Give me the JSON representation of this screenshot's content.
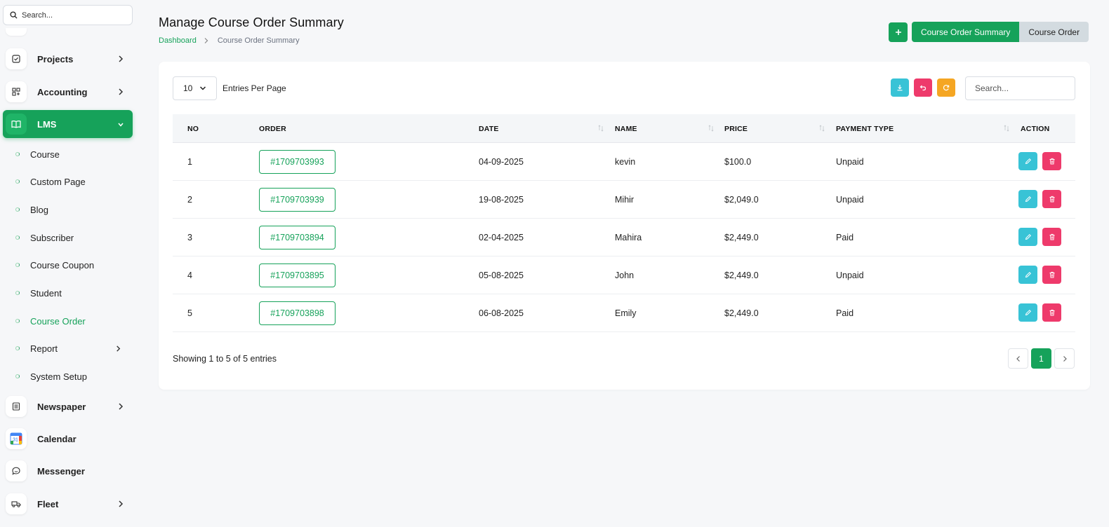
{
  "sidebar": {
    "search_placeholder": "Search...",
    "items": [
      {
        "label": "Projects",
        "icon": "checkbox-icon"
      },
      {
        "label": "Accounting",
        "icon": "grid-plus-icon"
      },
      {
        "label": "LMS",
        "icon": "book-open-icon"
      },
      {
        "label": "Newspaper",
        "icon": "newspaper-icon"
      },
      {
        "label": "Calendar",
        "icon": "calendar-app-icon"
      },
      {
        "label": "Messenger",
        "icon": "chat-icon"
      },
      {
        "label": "Fleet",
        "icon": "truck-icon"
      }
    ],
    "lms_sub": [
      {
        "label": "Course"
      },
      {
        "label": "Custom Page"
      },
      {
        "label": "Blog"
      },
      {
        "label": "Subscriber"
      },
      {
        "label": "Course Coupon"
      },
      {
        "label": "Student"
      },
      {
        "label": "Course Order"
      },
      {
        "label": "Report"
      },
      {
        "label": "System Setup"
      }
    ],
    "calendar_icon_text": "31"
  },
  "header": {
    "title": "Manage Course Order Summary",
    "breadcrumb": {
      "root": "Dashboard",
      "current": "Course Order Summary"
    },
    "buttons": {
      "summary": "Course Order Summary",
      "order": "Course Order"
    }
  },
  "table": {
    "per_page": "10",
    "per_page_label": "Entries Per Page",
    "search_placeholder": "Search...",
    "columns": [
      "NO",
      "ORDER",
      "DATE",
      "NAME",
      "PRICE",
      "PAYMENT TYPE",
      "ACTION"
    ],
    "rows": [
      {
        "no": "1",
        "order": "#1709703993",
        "date": "04-09-2025",
        "name": "kevin",
        "price": "$100.0",
        "payment": "Unpaid"
      },
      {
        "no": "2",
        "order": "#1709703939",
        "date": "19-08-2025",
        "name": "Mihir",
        "price": "$2,049.0",
        "payment": "Unpaid"
      },
      {
        "no": "3",
        "order": "#1709703894",
        "date": "02-04-2025",
        "name": "Mahira",
        "price": "$2,449.0",
        "payment": "Paid"
      },
      {
        "no": "4",
        "order": "#1709703895",
        "date": "05-08-2025",
        "name": "John",
        "price": "$2,449.0",
        "payment": "Unpaid"
      },
      {
        "no": "5",
        "order": "#1709703898",
        "date": "06-08-2025",
        "name": "Emily",
        "price": "$2,449.0",
        "payment": "Paid"
      }
    ],
    "showing": "Showing 1 to 5 of 5 entries",
    "current_page": "1"
  },
  "colors": {
    "primary": "#16a25a",
    "info": "#38c3d6",
    "danger": "#ee3a6b",
    "warning": "#f5a623",
    "secondary": "#d3dbe0"
  }
}
